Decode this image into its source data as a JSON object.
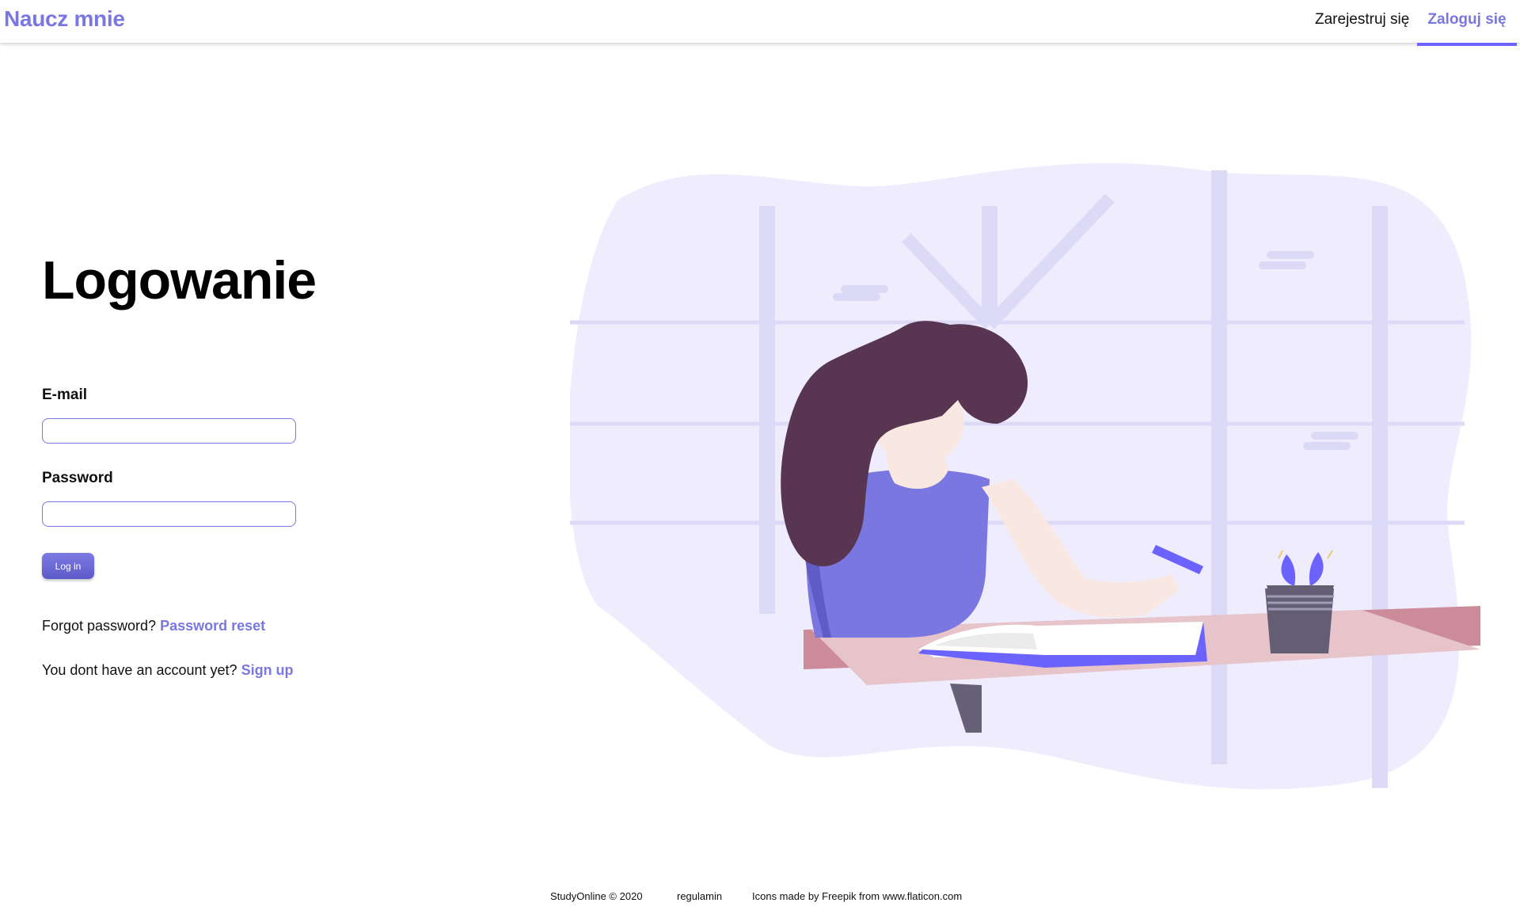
{
  "header": {
    "brand": "Naucz mnie",
    "nav": {
      "register": "Zarejestruj się",
      "login": "Zaloguj się"
    }
  },
  "login": {
    "title": "Logowanie",
    "email_label": "E-mail",
    "email_value": "",
    "password_label": "Password",
    "password_value": "",
    "button_label": "Log in",
    "forgot_text": "Forgot password?",
    "forgot_link": "Password reset",
    "signup_text": "You dont have an account yet?",
    "signup_link": "Sign up"
  },
  "footer": {
    "copyright": "StudyOnline © 2020",
    "terms": "regulamin",
    "credits": "Icons made by Freepik from www.flaticon.com"
  },
  "colors": {
    "accent": "#7a77e0",
    "button": "#6c63ff",
    "blob": "#efedfd"
  },
  "illustration": {
    "name": "woman-studying-at-desk-illustration"
  }
}
